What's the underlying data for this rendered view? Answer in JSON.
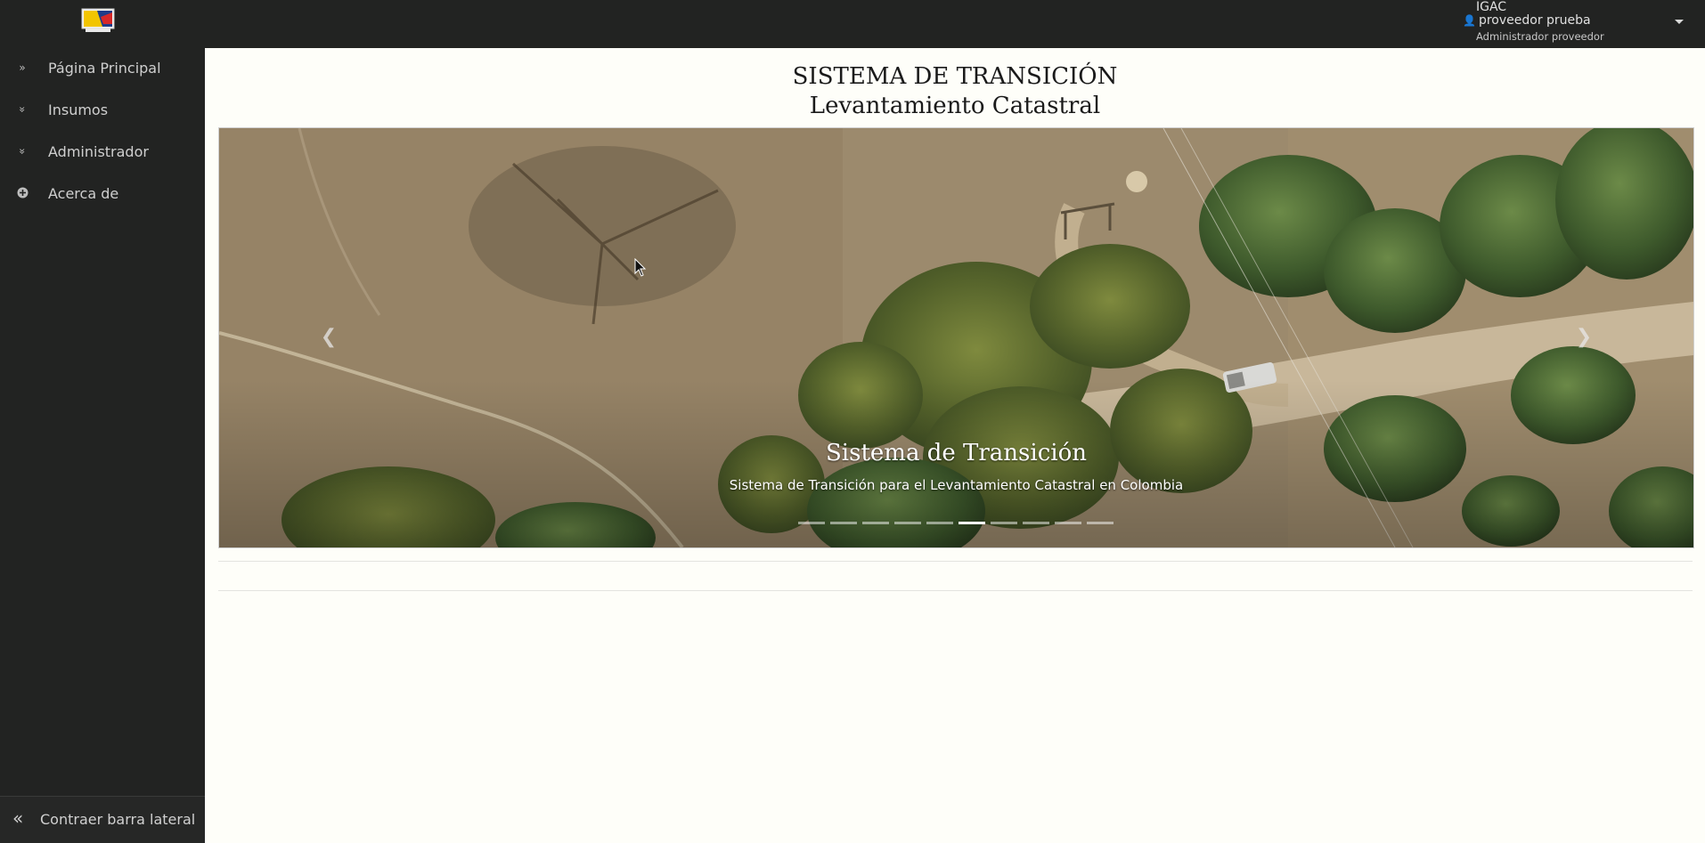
{
  "header": {
    "user": {
      "org": "IGAC",
      "name": "proveedor prueba",
      "role": "Administrador proveedor",
      "icon": "user-icon"
    }
  },
  "sidebar": {
    "items": [
      {
        "label": "Página Principal",
        "icon": "double-chevron-right-icon"
      },
      {
        "label": "Insumos",
        "icon": "double-chevron-down-icon"
      },
      {
        "label": "Administrador",
        "icon": "double-chevron-down-icon"
      },
      {
        "label": "Acerca de",
        "icon": "plus-circle-icon"
      }
    ],
    "collapse_label": "Contraer barra lateral"
  },
  "main": {
    "title_line1": "SISTEMA DE TRANSICIÓN",
    "title_line2": "Levantamiento Catastral"
  },
  "carousel": {
    "caption_title": "Sistema de Transición",
    "caption_text": "Sistema de Transición para el Levantamiento Catastral en Colombia",
    "slide_count": 10,
    "active_index": 5
  },
  "colors": {
    "topbar": "#222322",
    "sidebar": "#222322",
    "page_bg": "#fefef9"
  }
}
